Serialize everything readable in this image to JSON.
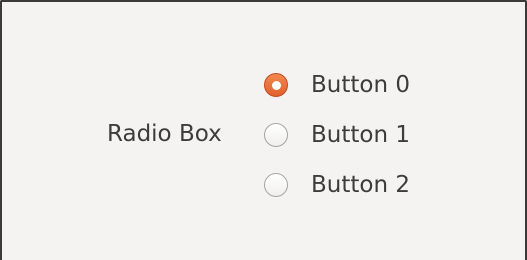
{
  "radio_box": {
    "label": "Radio Box",
    "accent_color": "#e86a35",
    "selected_index": 0,
    "options": [
      {
        "label": "Button 0",
        "checked": true
      },
      {
        "label": "Button 1",
        "checked": false
      },
      {
        "label": "Button 2",
        "checked": false
      }
    ]
  }
}
